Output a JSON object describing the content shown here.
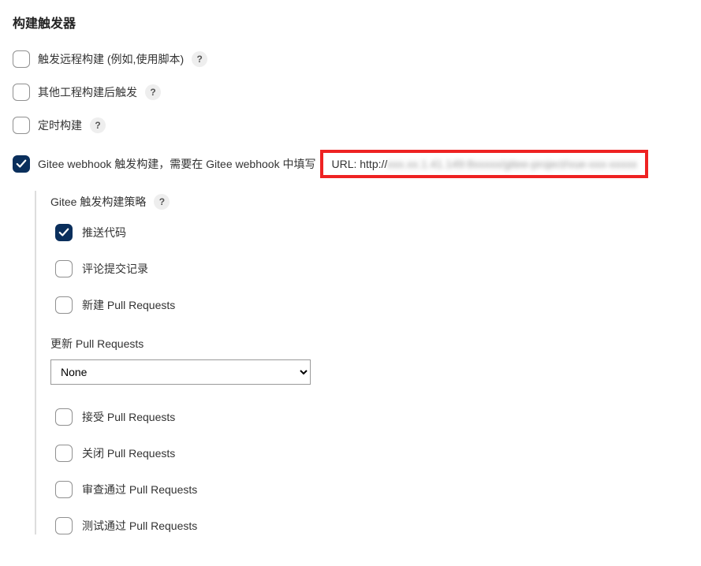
{
  "section_title": "构建触发器",
  "triggers": {
    "remote": {
      "label": "触发远程构建 (例如,使用脚本)",
      "checked": false
    },
    "after_other": {
      "label": "其他工程构建后触发",
      "checked": false
    },
    "scheduled": {
      "label": "定时构建",
      "checked": false
    },
    "gitee_webhook": {
      "prefix_label": "Gitee webhook 触发构建，需要在 Gitee webhook 中填写",
      "url_label": "URL: http://",
      "url_blurred": "xxx.xx.1.41.149:8xxxxx/gitee-project/vue-xxx-xxxxx",
      "checked": true
    }
  },
  "gitee_strategy": {
    "title": "Gitee 触发构建策略",
    "push_code": {
      "label": "推送代码",
      "checked": true
    },
    "comment_commit": {
      "label": "评论提交记录",
      "checked": false
    },
    "new_pr": {
      "label": "新建 Pull Requests",
      "checked": false
    },
    "update_pr_label": "更新 Pull Requests",
    "update_pr_value": "None",
    "accept_pr": {
      "label": "接受 Pull Requests",
      "checked": false
    },
    "close_pr": {
      "label": "关闭 Pull Requests",
      "checked": false
    },
    "review_pass_pr": {
      "label": "审查通过 Pull Requests",
      "checked": false
    },
    "test_pass_pr": {
      "label": "测试通过 Pull Requests",
      "checked": false
    }
  },
  "help_glyph": "?"
}
